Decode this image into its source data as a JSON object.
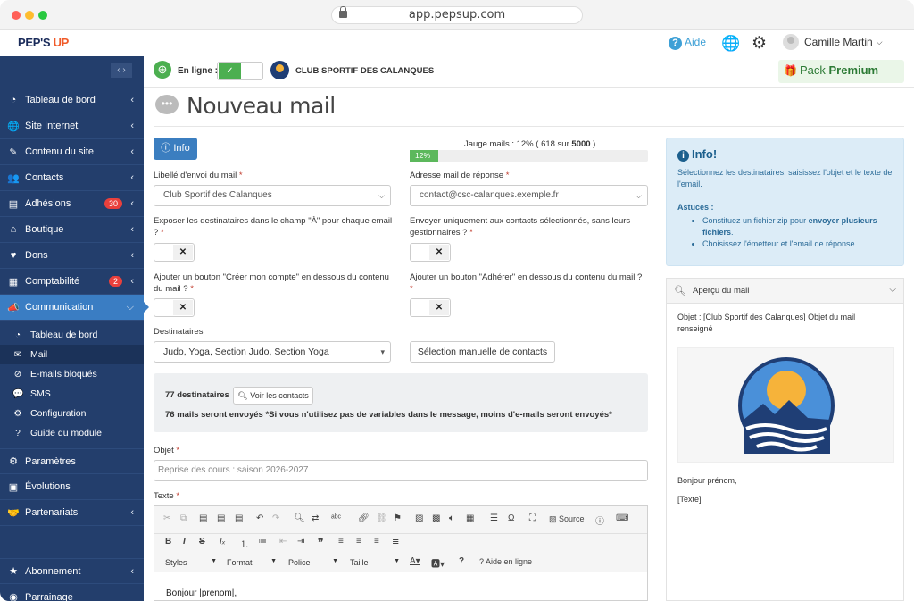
{
  "browser": {
    "url": "app.pepsup.com"
  },
  "brand": {
    "name_a": "PEP'S",
    "name_b": "UP",
    "accent": "#f05a28"
  },
  "topbar": {
    "help_label": "Aide",
    "user_name": "Camille Martin"
  },
  "sidebar": {
    "collapse_label": "‹ ›",
    "items": [
      {
        "label": "Tableau de bord",
        "icon": "dashboard-icon",
        "glyph": "◔"
      },
      {
        "label": "Site Internet",
        "icon": "globe-icon",
        "glyph": "🌐"
      },
      {
        "label": "Contenu du site",
        "icon": "pencil-icon",
        "glyph": "✎"
      },
      {
        "label": "Contacts",
        "icon": "users-icon",
        "glyph": "👥"
      },
      {
        "label": "Adhésions",
        "icon": "id-card-icon",
        "glyph": "▤",
        "badge": "30"
      },
      {
        "label": "Boutique",
        "icon": "shop-icon",
        "glyph": "⌂"
      },
      {
        "label": "Dons",
        "icon": "hand-heart-icon",
        "glyph": "♥"
      },
      {
        "label": "Comptabilité",
        "icon": "calculator-icon",
        "glyph": "▦",
        "badge": "2"
      },
      {
        "label": "Communication",
        "icon": "megaphone-icon",
        "glyph": "📣"
      }
    ],
    "sub_items": [
      {
        "label": "Tableau de bord",
        "glyph": "◔"
      },
      {
        "label": "Mail",
        "glyph": "✉"
      },
      {
        "label": "E-mails bloqués",
        "glyph": "⊘"
      },
      {
        "label": "SMS",
        "glyph": "💬"
      },
      {
        "label": "Configuration",
        "glyph": "⚙"
      },
      {
        "label": "Guide du module",
        "glyph": "?"
      }
    ],
    "bottom_items": [
      {
        "label": "Paramètres",
        "glyph": "⚙"
      },
      {
        "label": "Évolutions",
        "glyph": "▣"
      },
      {
        "label": "Partenariats",
        "glyph": "🤝"
      }
    ],
    "footer_items": [
      {
        "label": "Abonnement",
        "glyph": "★"
      },
      {
        "label": "Parrainage",
        "glyph": "◉"
      }
    ]
  },
  "header": {
    "online_label": "En ligne :",
    "club_name": "CLUB SPORTIF DES CALANQUES",
    "pack_label": "Pack",
    "pack_name": "Premium"
  },
  "page": {
    "title": "Nouveau mail"
  },
  "form": {
    "info_button": "Info",
    "jauge_prefix": "Jauge mails : 12% ( 618 sur ",
    "jauge_total": "5000",
    "jauge_suffix": " )",
    "jauge_percent": 12,
    "jauge_text": "12%",
    "sender_label": "Libellé d'envoi du mail",
    "sender_value": "Club Sportif des Calanques",
    "reply_label": "Adresse mail de réponse",
    "reply_value": "contact@csc-calanques.exemple.fr",
    "expose_label": "Exposer les destinataires dans le champ \"À\" pour chaque email ?",
    "only_contacts_label": "Envoyer uniquement aux contacts sélectionnés, sans leurs gestionnaires ?",
    "create_account_label": "Ajouter un bouton \"Créer mon compte\" en dessous du contenu du mail ?",
    "adherer_label": "Ajouter un bouton \"Adhérer\" en dessous du contenu du mail ?",
    "toggle_off_glyph": "✕",
    "dest_label": "Destinataires",
    "dest_value": "Judo, Yoga, Section Judo, Section Yoga",
    "manual_button": "Sélection manuelle de contacts",
    "recipients_count": "77 destinataires",
    "voir_contacts": "Voir les contacts",
    "mails_sent": "76 mails seront envoyés *Si vous n'utilisez pas de variables dans le message, moins d'e-mails seront envoyés*",
    "objet_label": "Objet",
    "objet_placeholder": "Reprise des cours : saison 2026-2027",
    "texte_label": "Texte",
    "editor_body": "Bonjour |prenom|,",
    "required_mark": "*"
  },
  "editor": {
    "source_label": "Source",
    "styles": "Styles",
    "format": "Format",
    "police": "Police",
    "taille": "Taille",
    "help": "Aide en ligne"
  },
  "infobox": {
    "title": "Info!",
    "text": "Sélectionnez les destinataires, saisissez l'objet et le texte de l'email.",
    "astuces": "Astuces :",
    "tip1_a": "Constituez un fichier zip pour ",
    "tip1_b": "envoyer plusieurs fichiers",
    "tip1_c": ".",
    "tip2": "Choisissez l'émetteur et l'email de réponse."
  },
  "preview": {
    "title": "Aperçu du mail",
    "objet": "Objet : [Club Sportif des Calanques] Objet du mail renseigné",
    "greeting": "Bonjour prénom,",
    "text": "[Texte]"
  }
}
